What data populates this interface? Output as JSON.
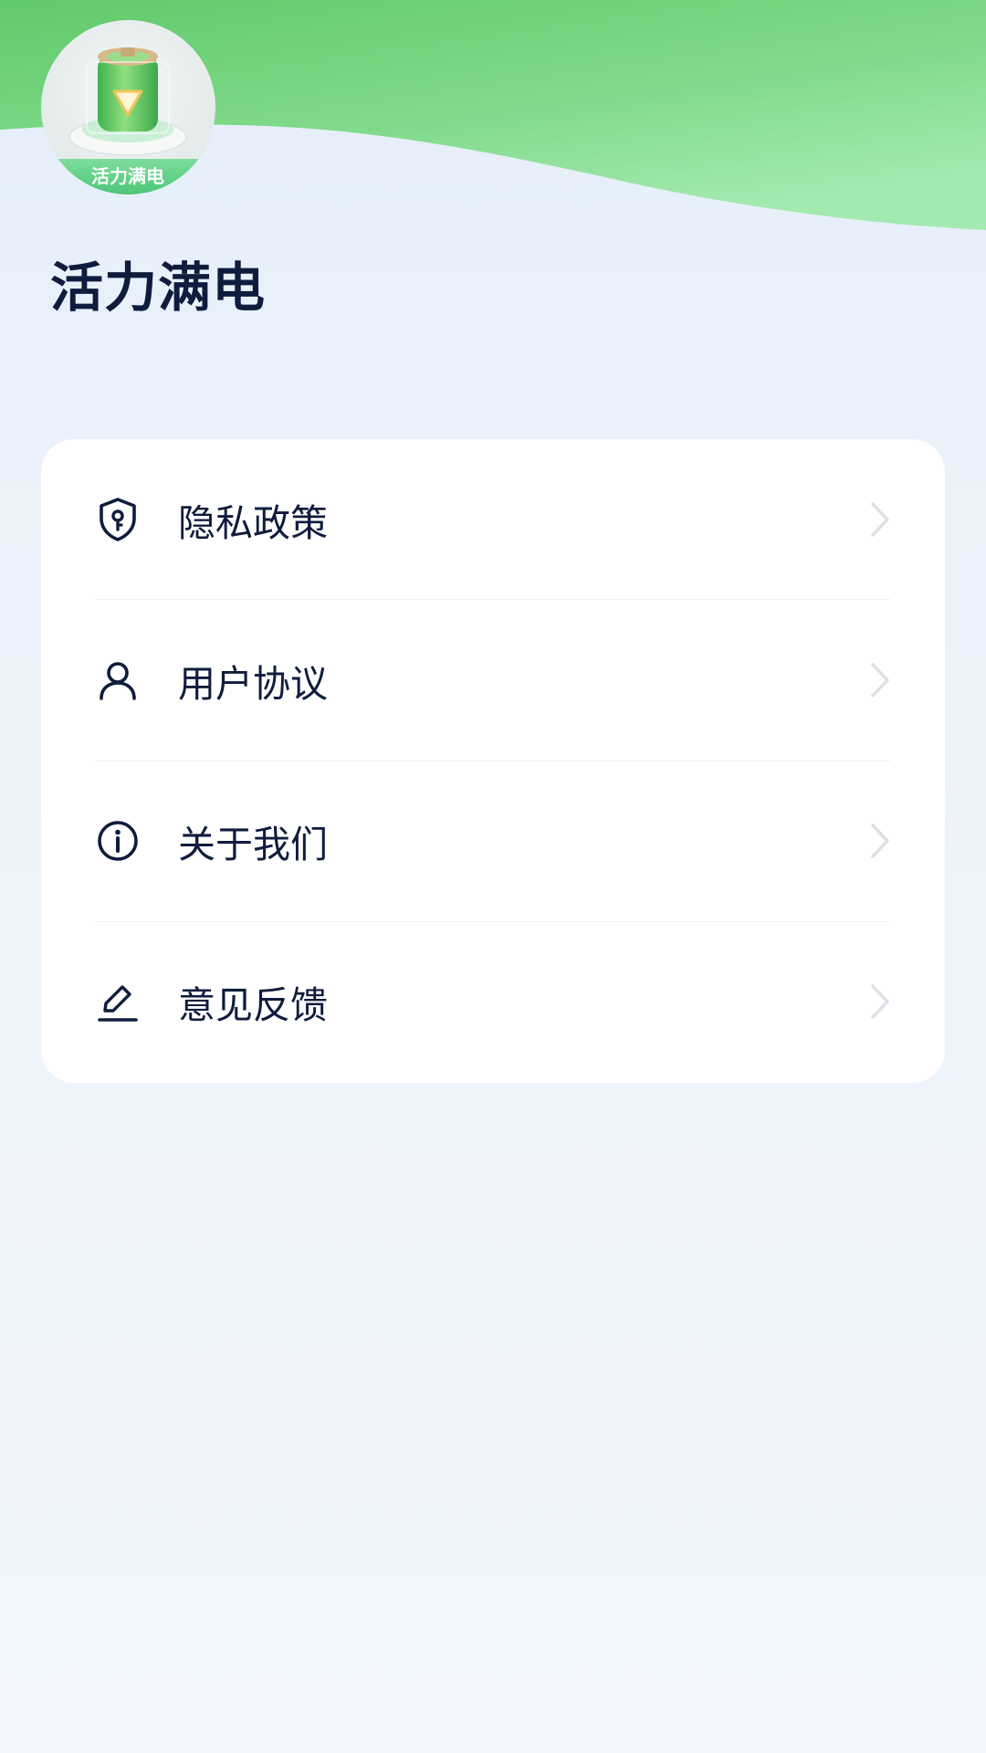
{
  "app": {
    "name": "活力满电",
    "logo_text": "活力满电"
  },
  "menu": {
    "items": [
      {
        "label": "隐私政策",
        "icon": "shield-key-icon"
      },
      {
        "label": "用户协议",
        "icon": "user-icon"
      },
      {
        "label": "关于我们",
        "icon": "info-icon"
      },
      {
        "label": "意见反馈",
        "icon": "edit-pencil-icon"
      }
    ]
  },
  "colors": {
    "header_green": "#6ccf73",
    "text_dark": "#0f1c3d",
    "chevron": "#dde1e7",
    "card_bg": "#ffffff",
    "page_bg": "#edf3fb"
  }
}
